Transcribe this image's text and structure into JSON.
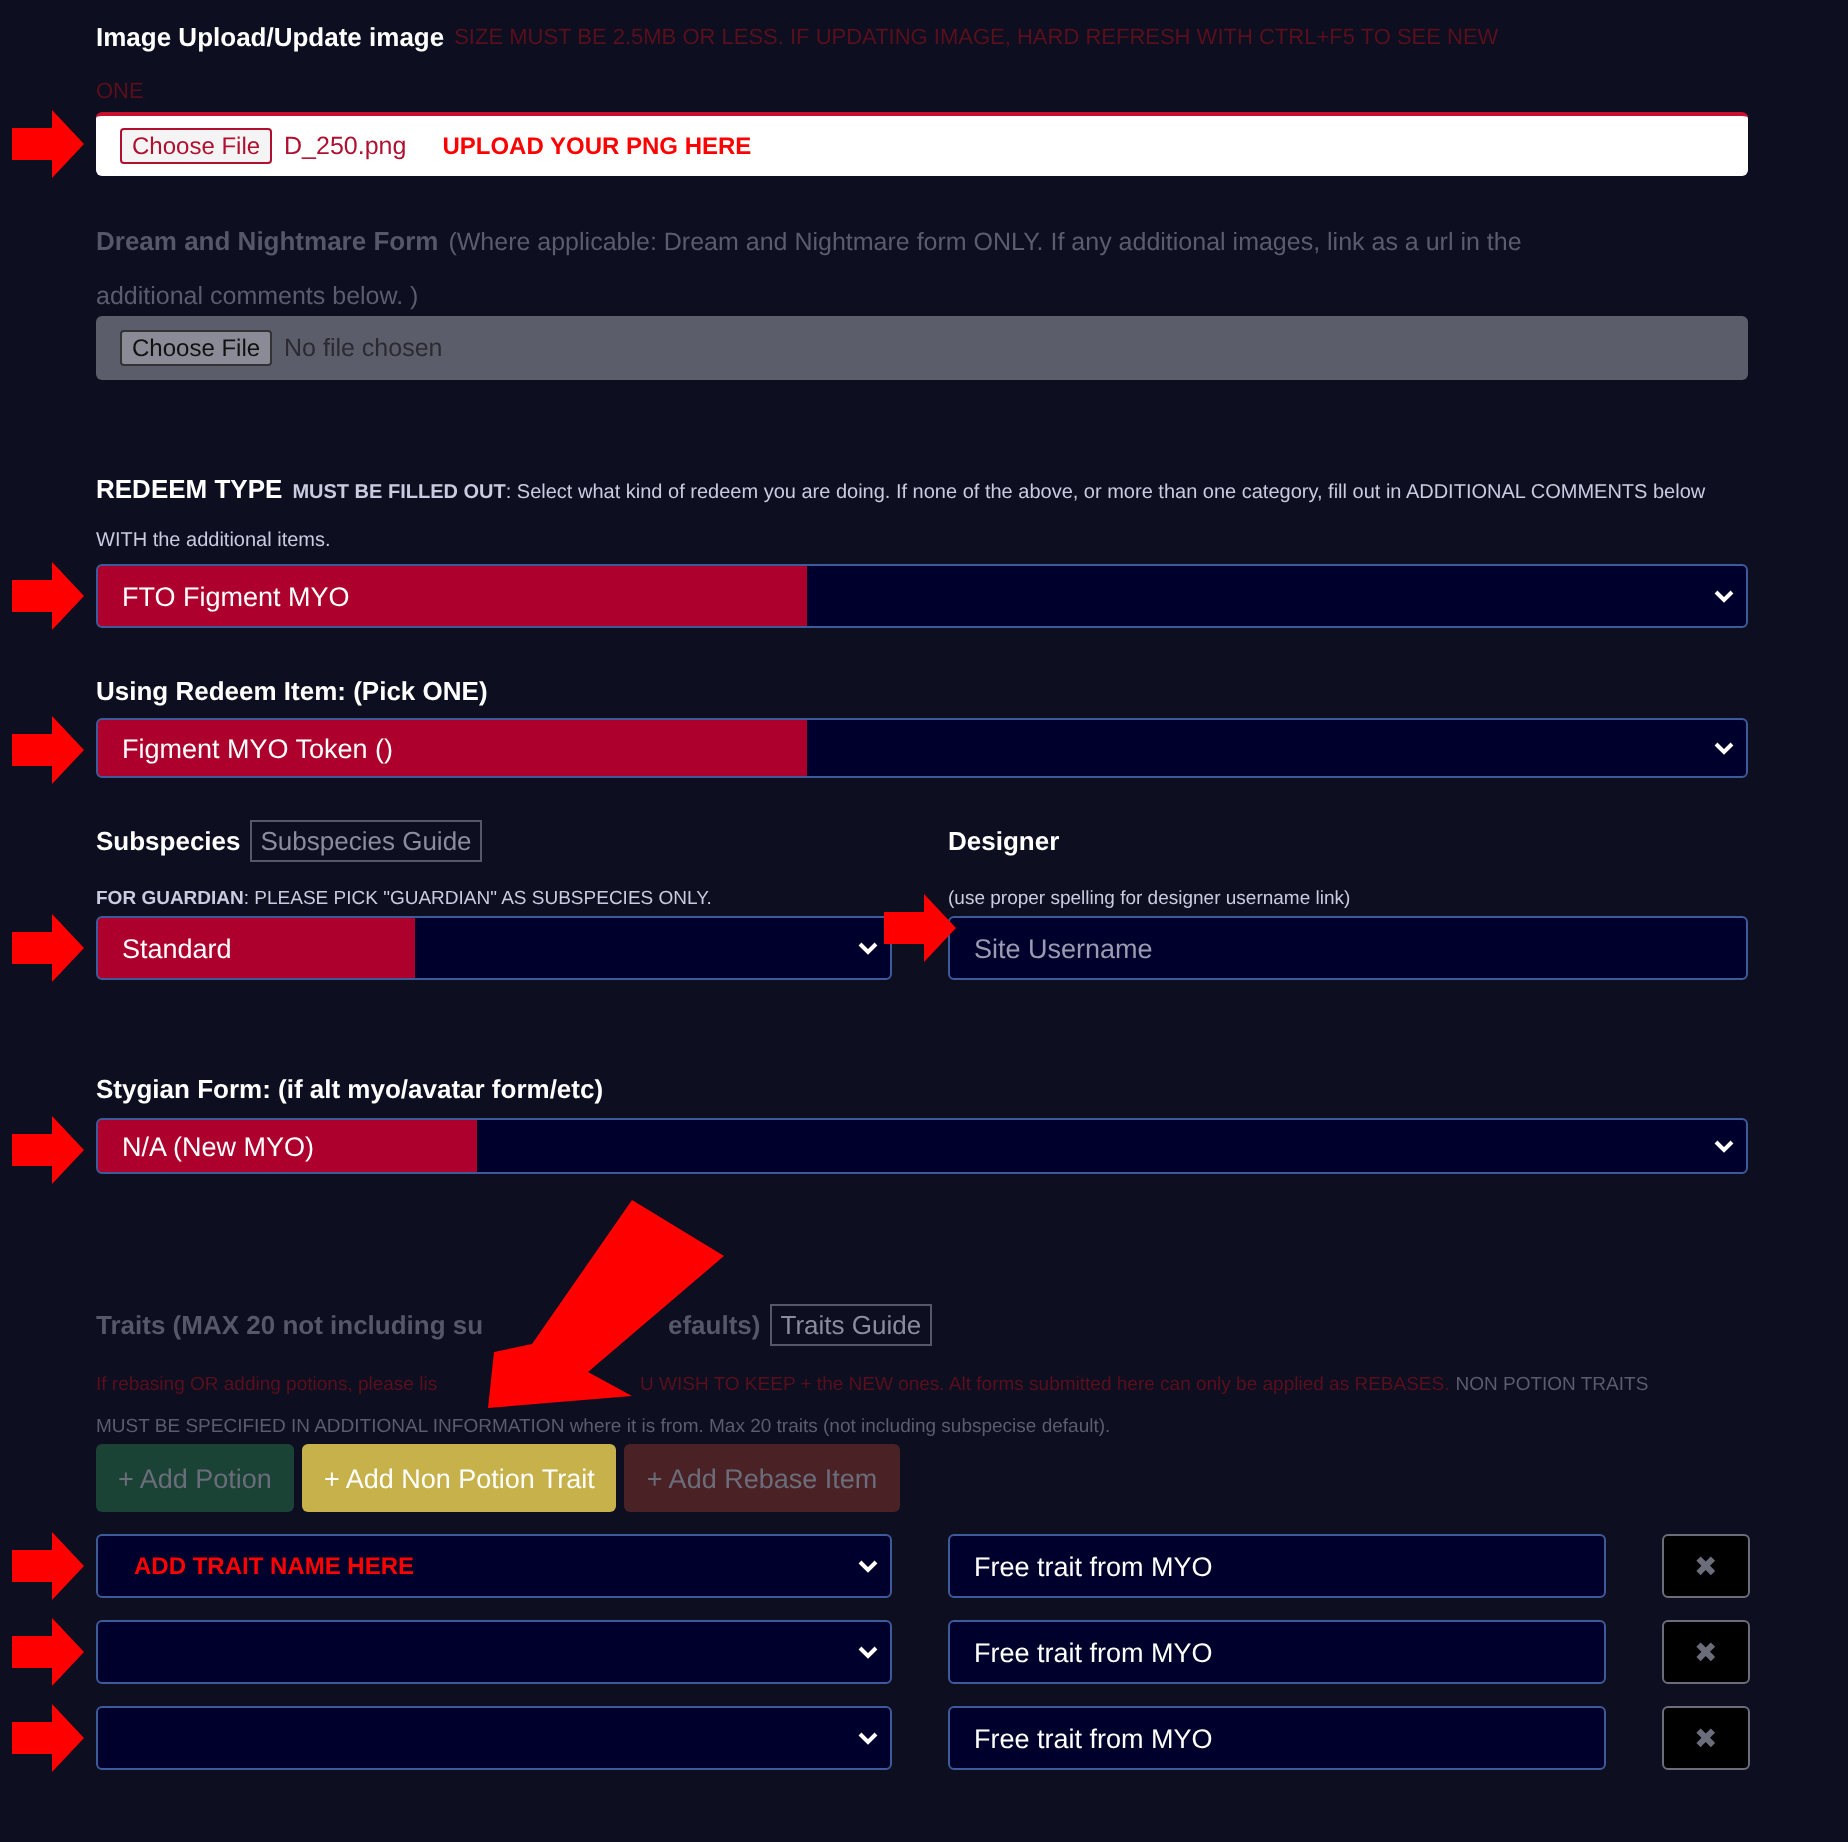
{
  "image_upload": {
    "label": "Image Upload/Update image",
    "warning_lines": [
      "SIZE MUST BE 2.5MB OR LESS. IF UPDATING IMAGE, HARD REFRESH WITH CTRL+F5 TO SEE NEW",
      "ONE"
    ],
    "button": "Choose File",
    "file_name": "D_250.png",
    "annotation": "UPLOAD YOUR PNG HERE"
  },
  "dream_upload": {
    "label": "Dream and Nightmare Form",
    "note_lines": [
      "(Where applicable: Dream and Nightmare form ONLY. If any additional images, link as a url in the",
      "additional comments below. )"
    ],
    "button": "Choose File",
    "file_name": "No file chosen",
    "disabled": true
  },
  "redeem_type": {
    "label": "REDEEM TYPE",
    "note_lines": [
      "**MUST BE FILLED OUT**: Select what kind of redeem you are doing. If none of the above, or more than one category, fill out in ADDITIONAL COMMENTS below",
      "WITH the additional items."
    ],
    "value": "FTO Figment MYO"
  },
  "redeem_item": {
    "label": "Using Redeem Item: (Pick ONE)",
    "value": "Figment MYO Token ()"
  },
  "subspecies": {
    "label": "Subspecies",
    "guide": "Subspecies Guide",
    "note": "**FOR GUARDIAN**: PLEASE PICK \"GUARDIAN\" AS SUBSPECIES ONLY.",
    "value": "Standard"
  },
  "designer": {
    "label": "Designer",
    "note": "(use proper spelling for designer username link)",
    "placeholder": "Site Username"
  },
  "stygian": {
    "label": "Stygian Form: (if alt myo/avatar form/etc)",
    "value": "N/A (New MYO)"
  },
  "traits": {
    "label_parts": [
      "Traits (MAX 20 not including su",
      "efaults)"
    ],
    "guide": "Traits Guide",
    "warning_parts": [
      "If rebasing OR adding potions, please lis",
      "U WISH TO KEEP + the NEW ones. Alt forms submitted here can only be applied as REBASES."
    ],
    "note_lines": [
      "NON POTION TRAITS",
      "MUST BE SPECIFIED IN ADDITIONAL INFORMATION where it is from. Max 20 traits (not including subspecise default)."
    ],
    "buttons": [
      {
        "label": "+ Add Potion",
        "kind": "potion"
      },
      {
        "label": "+ Add Non Potion Trait",
        "kind": "trait"
      },
      {
        "label": "+ Add Rebase Item",
        "kind": "rebase"
      }
    ],
    "rows": [
      {
        "annotation": "ADD TRAIT NAME HERE",
        "value": "Free trait from MYO",
        "remove": "✖"
      },
      {
        "value": "Free trait from MYO",
        "remove": "✖"
      },
      {
        "value": "Free trait from MYO",
        "remove": "✖"
      }
    ]
  }
}
